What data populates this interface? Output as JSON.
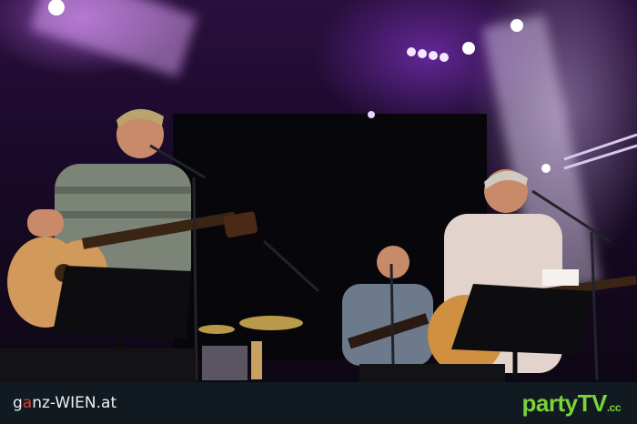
{
  "watermark_left": {
    "prefix": "g",
    "accent": "a",
    "suffix": "nz-WIEN.at"
  },
  "watermark_right": {
    "main": "partyTV",
    "tld": ".cc"
  },
  "colors": {
    "stage_purple": "#6a2a9a",
    "watermark_bar": "#101a20",
    "party_green": "#7bd23b",
    "accent_red": "#e04030"
  }
}
